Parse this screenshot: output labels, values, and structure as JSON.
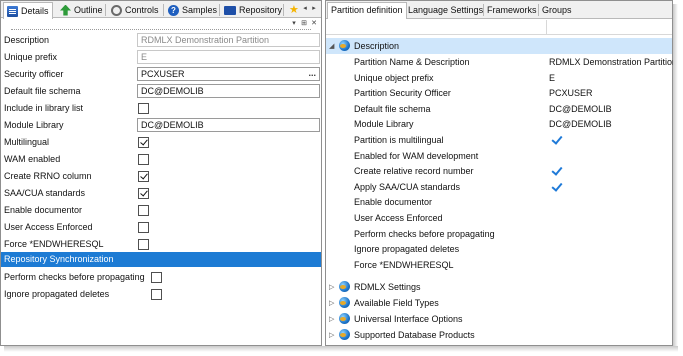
{
  "left_tabs": [
    {
      "label": "Details",
      "icon": "details-icon"
    },
    {
      "label": "Outline",
      "icon": "outline-icon"
    },
    {
      "label": "Controls",
      "icon": "controls-icon"
    },
    {
      "label": "Samples",
      "icon": "samples-icon"
    },
    {
      "label": "Repository",
      "icon": "repository-icon"
    },
    {
      "label": "",
      "icon": "star-icon"
    }
  ],
  "toolbar": {
    "dropdown": "▾",
    "pin": "⊞",
    "close": "✕"
  },
  "props": {
    "description": {
      "label": "Description",
      "value": "RDMLX Demonstration Partition"
    },
    "unique_prefix": {
      "label": "Unique prefix",
      "value": "E"
    },
    "security_officer": {
      "label": "Security officer",
      "value": "PCXUSER",
      "button": "..."
    },
    "default_file_schema": {
      "label": "Default file schema",
      "value": "DC@DEMOLIB"
    },
    "include_in_library_list": {
      "label": "Include in library list",
      "checked": false
    },
    "module_library": {
      "label": "Module Library",
      "value": "DC@DEMOLIB"
    },
    "multilingual": {
      "label": "Multilingual",
      "checked": true
    },
    "wam_enabled": {
      "label": "WAM enabled",
      "checked": false
    },
    "create_rrno_column": {
      "label": "Create RRNO column",
      "checked": true
    },
    "saa_cua_standards": {
      "label": "SAA/CUA standards",
      "checked": true
    },
    "enable_documentor": {
      "label": "Enable documentor",
      "checked": false
    },
    "user_access_enforced": {
      "label": "User Access Enforced",
      "checked": false
    },
    "force_endwheresql": {
      "label": "Force *ENDWHERESQL",
      "checked": false
    }
  },
  "repository_sync": {
    "title": "Repository Synchronization",
    "perform_checks": {
      "label": "Perform checks before propagating",
      "checked": false
    },
    "ignore_deletes": {
      "label": "Ignore propagated deletes",
      "checked": false
    }
  },
  "right_tabs": [
    "Partition definition",
    "Language Settings",
    "Frameworks",
    "Groups"
  ],
  "grid": {
    "description_group": {
      "label": "Description",
      "expander": "◢"
    },
    "rows": [
      {
        "name": "Partition Name & Description",
        "value": "RDMLX Demonstration Partition"
      },
      {
        "name": "Unique object prefix",
        "value": "E"
      },
      {
        "name": "Partition Security Officer",
        "value": "PCXUSER"
      },
      {
        "name": "Default file schema",
        "value": "DC@DEMOLIB"
      },
      {
        "name": "Module Library",
        "value": "DC@DEMOLIB"
      },
      {
        "name": "Partition is multilingual",
        "value": "",
        "checked": true
      },
      {
        "name": "Enabled for WAM development",
        "value": ""
      },
      {
        "name": "Create relative record number",
        "value": "",
        "checked": true
      },
      {
        "name": "Apply SAA/CUA standards",
        "value": "",
        "checked": true
      },
      {
        "name": "Enable documentor",
        "value": ""
      },
      {
        "name": "User Access Enforced",
        "value": ""
      },
      {
        "name": "Perform checks before propagating",
        "value": ""
      },
      {
        "name": "Ignore propagated deletes",
        "value": ""
      },
      {
        "name": "Force *ENDWHERESQL",
        "value": ""
      }
    ],
    "collapsed_groups": [
      {
        "label": "RDMLX Settings",
        "expander": "▷"
      },
      {
        "label": "Available Field Types",
        "expander": "▷"
      },
      {
        "label": "Universal Interface Options",
        "expander": "▷"
      },
      {
        "label": "Supported Database Products",
        "expander": "▷"
      }
    ]
  },
  "colors": {
    "accent": "#1d7bd4",
    "selected_group": "#cfe6fb",
    "check": "#1f7ad8"
  }
}
